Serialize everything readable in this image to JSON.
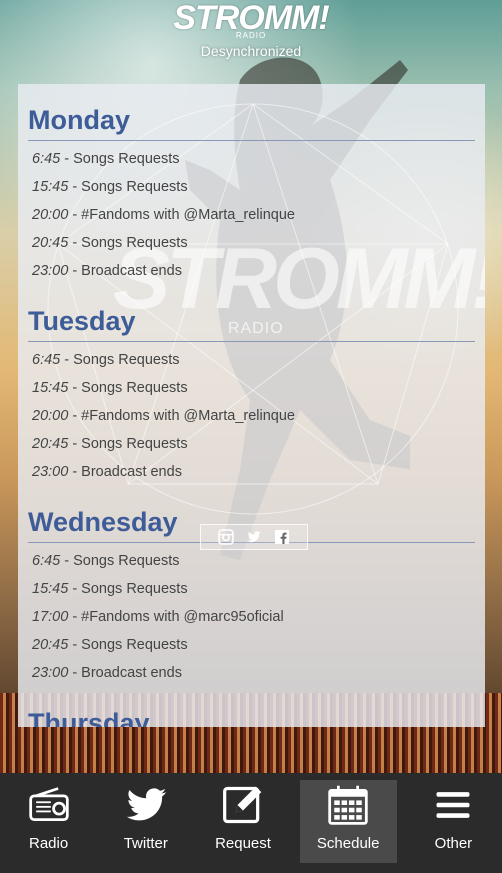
{
  "header": {
    "logo_text": "STROMM!",
    "logo_sub": "RADIO",
    "tagline": "Desynchronized"
  },
  "watermark": {
    "logo_text": "STROMM!",
    "logo_sub": "RADIO"
  },
  "social_icons": [
    "instagram-icon",
    "twitter-icon",
    "facebook-icon"
  ],
  "schedule": {
    "days": [
      {
        "name": "Monday",
        "entries": [
          {
            "time": "6:45",
            "title": " - Songs Requests"
          },
          {
            "time": "15:45",
            "title": " - Songs Requests"
          },
          {
            "time": "20:00",
            "title": " - #Fandoms with @Marta_relinque"
          },
          {
            "time": "20:45",
            "title": " - Songs Requests"
          },
          {
            "time": "23:00",
            "title": " - Broadcast ends"
          }
        ]
      },
      {
        "name": "Tuesday",
        "entries": [
          {
            "time": "6:45",
            "title": " - Songs Requests"
          },
          {
            "time": "15:45",
            "title": " - Songs Requests"
          },
          {
            "time": "20:00",
            "title": " - #Fandoms with @Marta_relinque"
          },
          {
            "time": "20:45",
            "title": " - Songs Requests"
          },
          {
            "time": "23:00",
            "title": " - Broadcast ends"
          }
        ]
      },
      {
        "name": "Wednesday",
        "entries": [
          {
            "time": "6:45",
            "title": " - Songs Requests"
          },
          {
            "time": "15:45",
            "title": " - Songs Requests"
          },
          {
            "time": "17:00",
            "title": " - #Fandoms with @marc95oficial"
          },
          {
            "time": "20:45",
            "title": " - Songs Requests"
          },
          {
            "time": "23:00",
            "title": " - Broadcast ends"
          }
        ]
      },
      {
        "name": "Thursday",
        "entries": []
      }
    ]
  },
  "nav": {
    "items": [
      {
        "label": "Radio",
        "icon": "radio-icon",
        "active": false
      },
      {
        "label": "Twitter",
        "icon": "twitter-icon",
        "active": false
      },
      {
        "label": "Request",
        "icon": "edit-icon",
        "active": false
      },
      {
        "label": "Schedule",
        "icon": "calendar-icon",
        "active": true
      },
      {
        "label": "Other",
        "icon": "menu-icon",
        "active": false
      }
    ]
  },
  "colors": {
    "accent": "#3d5c98",
    "nav_bg": "#2b2b2b",
    "nav_active": "#4a4a4a"
  }
}
